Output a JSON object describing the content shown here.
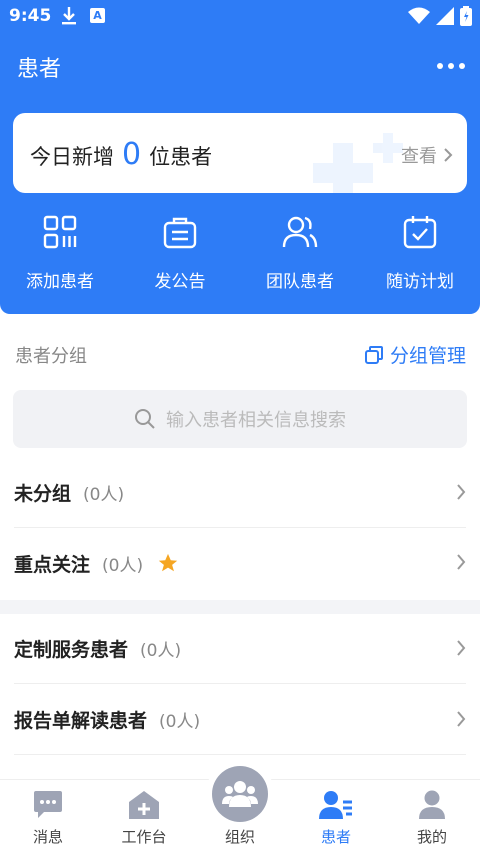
{
  "status": {
    "time": "9:45"
  },
  "topbar": {
    "title": "患者"
  },
  "summary": {
    "prefix": "今日新增",
    "count": "0",
    "suffix": "位患者",
    "link": "查看"
  },
  "actions": [
    {
      "label": "添加患者",
      "icon": "grid-icon"
    },
    {
      "label": "发公告",
      "icon": "bag-icon"
    },
    {
      "label": "团队患者",
      "icon": "users-icon"
    },
    {
      "label": "随访计划",
      "icon": "calendar-check-icon"
    }
  ],
  "groups": {
    "title": "患者分组",
    "manage": "分组管理"
  },
  "search": {
    "placeholder": "输入患者相关信息搜索"
  },
  "rows": [
    {
      "name": "未分组",
      "count": "(0人)"
    },
    {
      "name": "重点关注",
      "count": "(0人)"
    },
    {
      "name": "定制服务患者",
      "count": "(0人)"
    },
    {
      "name": "报告单解读患者",
      "count": "(0人)"
    }
  ],
  "tabs": [
    {
      "label": "消息"
    },
    {
      "label": "工作台"
    },
    {
      "label": "组织"
    },
    {
      "label": "患者"
    },
    {
      "label": "我的"
    }
  ],
  "colors": {
    "primary": "#2e7cf6",
    "star": "#f5a623",
    "tab_inactive": "#9ea4b5"
  }
}
